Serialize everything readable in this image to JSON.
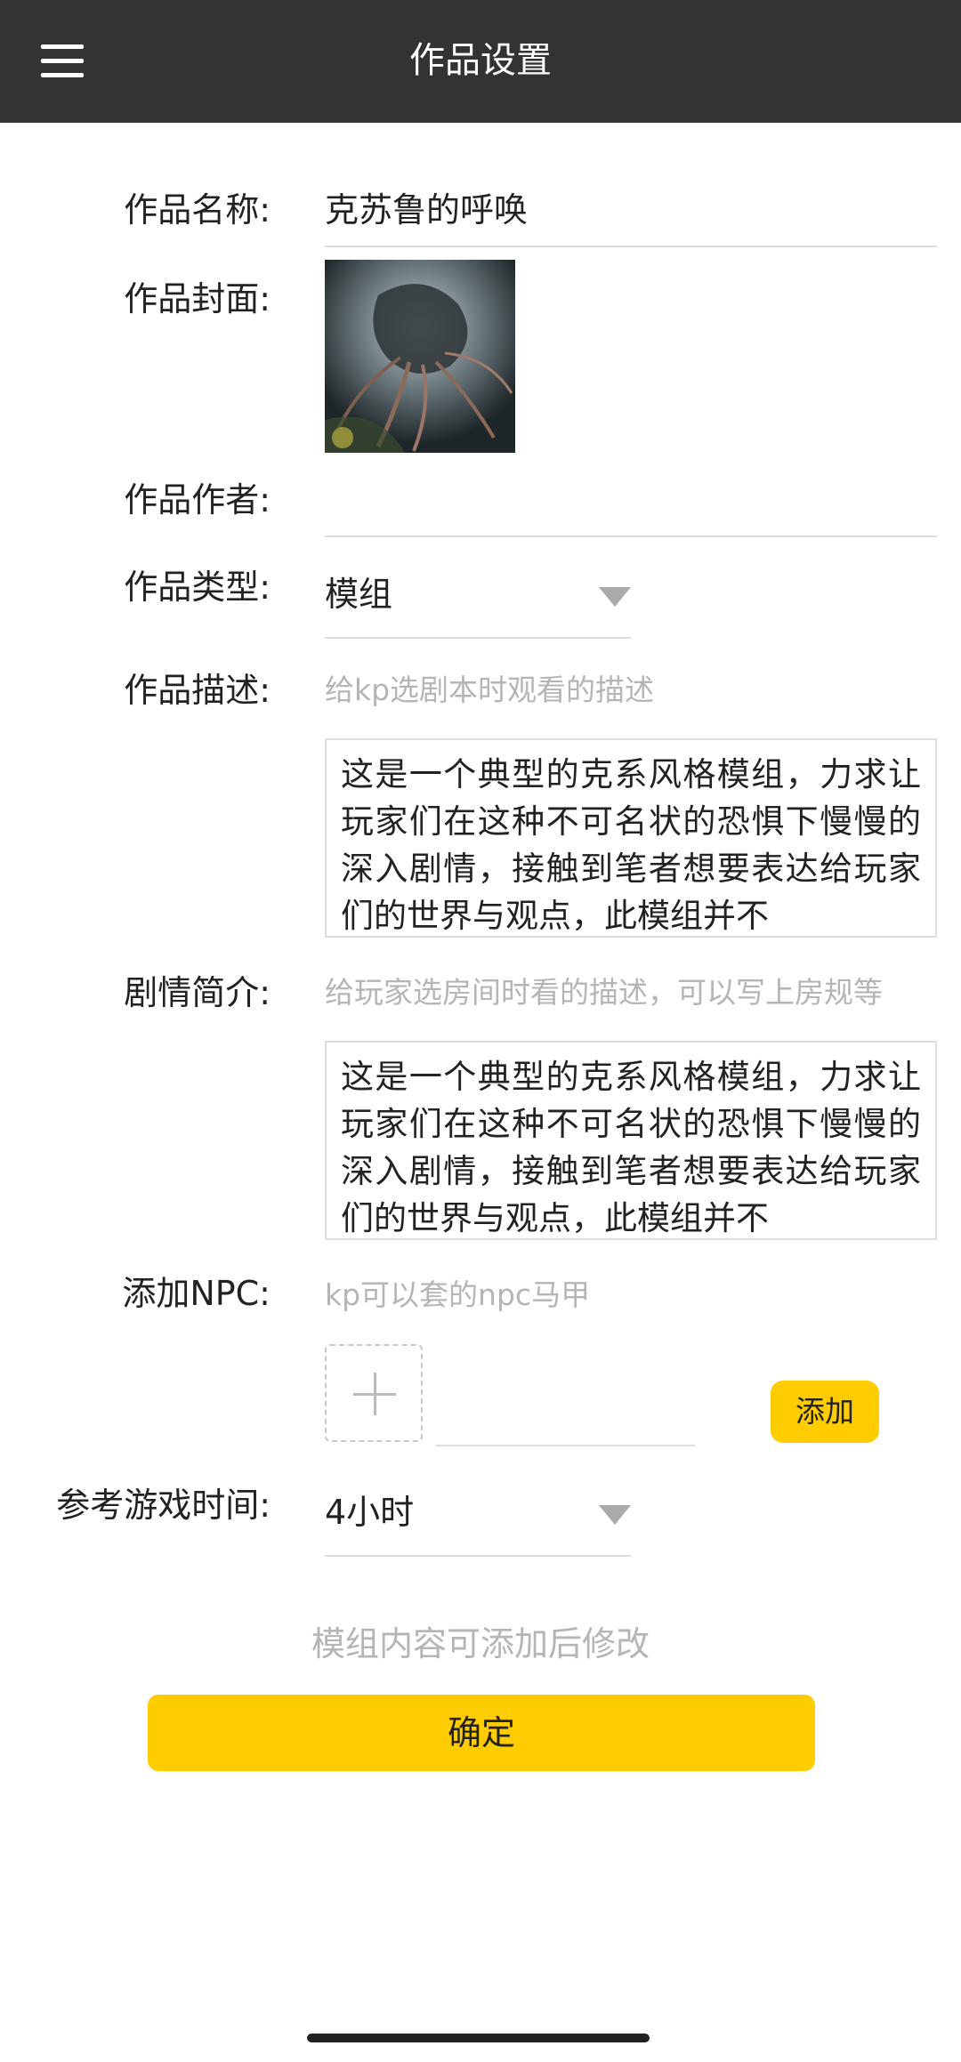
{
  "header": {
    "title": "作品设置"
  },
  "form": {
    "name": {
      "label": "作品名称:",
      "value": "克苏鲁的呼唤"
    },
    "cover": {
      "label": "作品封面:"
    },
    "author": {
      "label": "作品作者:",
      "value": ""
    },
    "type": {
      "label": "作品类型:",
      "value": "模组"
    },
    "description": {
      "label": "作品描述:",
      "hint": "给kp选剧本时观看的描述",
      "text": "这是一个典型的克系风格模组，力求让玩家们在这种不可名状的恐惧下慢慢的深入剧情，接触到笔者想要表达给玩家们的世界与观点，此模组并不"
    },
    "synopsis": {
      "label": "剧情简介:",
      "hint": "给玩家选房间时看的描述，可以写上房规等",
      "text": "这是一个典型的克系风格模组，力求让玩家们在这种不可名状的恐惧下慢慢的深入剧情，接触到笔者想要表达给玩家们的世界与观点，此模组并不"
    },
    "npc": {
      "label": "添加NPC:",
      "hint": "kp可以套的npc马甲",
      "add_button": "添加",
      "input_value": ""
    },
    "play_time": {
      "label": "参考游戏时间:",
      "value": "4小时"
    }
  },
  "footer": {
    "note": "模组内容可添加后修改",
    "confirm_label": "确定"
  },
  "colors": {
    "header_bg": "#333333",
    "accent": "#ffcc00",
    "hint": "#b5b5b5",
    "divider": "#dddddd"
  }
}
